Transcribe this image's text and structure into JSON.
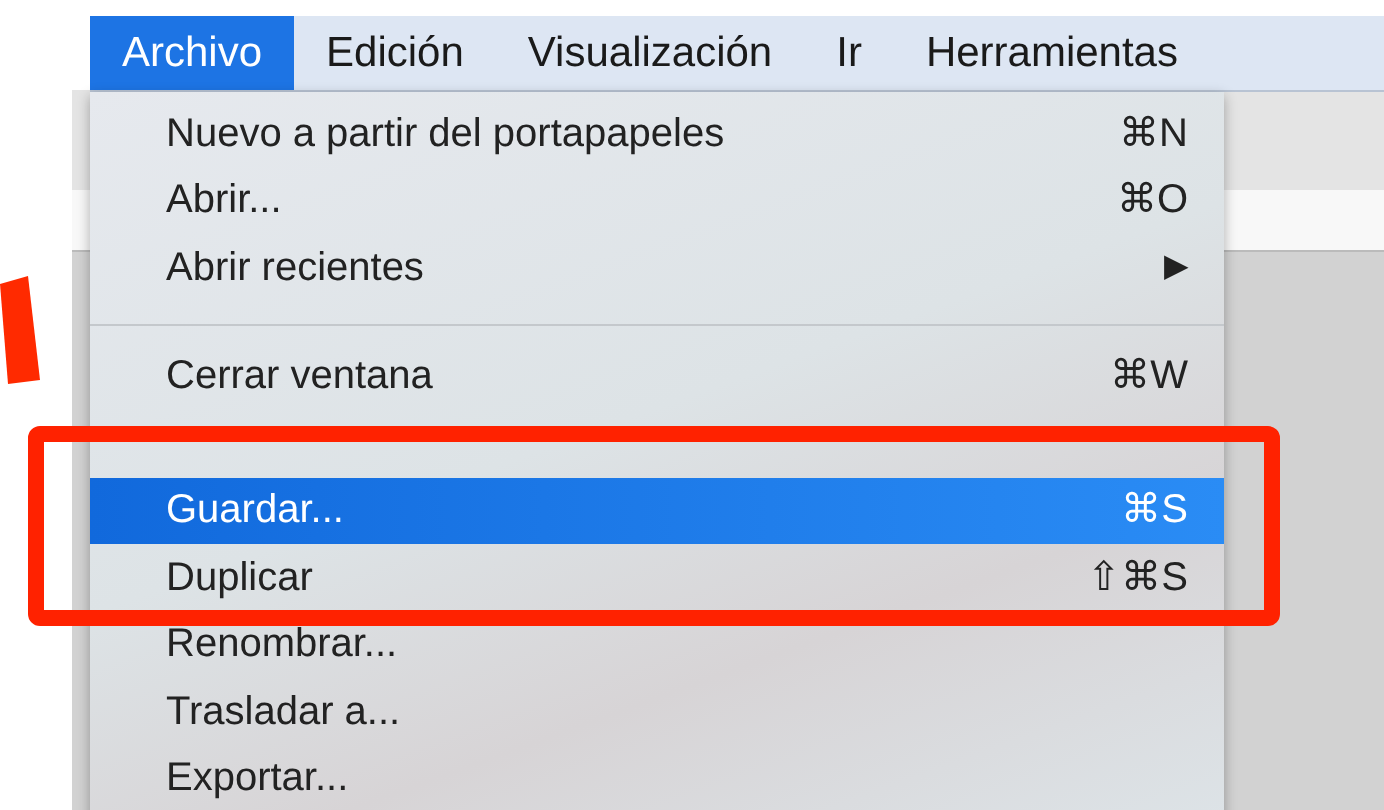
{
  "menu_bar": [
    {
      "label": "Archivo",
      "selected": true
    },
    {
      "label": "Edición",
      "selected": false
    },
    {
      "label": "Visualización",
      "selected": false
    },
    {
      "label": "Ir",
      "selected": false
    },
    {
      "label": "Herramientas",
      "selected": false
    }
  ],
  "menu": [
    {
      "kind": "item",
      "label": "Nuevo a partir del portapapeles",
      "shortcut": "⌘N",
      "selected": false
    },
    {
      "kind": "item",
      "label": "Abrir...",
      "shortcut": "⌘O",
      "selected": false
    },
    {
      "kind": "submenu",
      "label": "Abrir recientes",
      "shortcut": "▶",
      "selected": false
    },
    {
      "kind": "separator"
    },
    {
      "kind": "item",
      "label": "Cerrar ventana",
      "shortcut": "⌘W",
      "selected": false
    },
    {
      "kind": "covered"
    },
    {
      "kind": "item",
      "label": "Guardar...",
      "shortcut": "⌘S",
      "selected": true
    },
    {
      "kind": "item",
      "label": "Duplicar",
      "shortcut": "⇧⌘S",
      "selected": false
    },
    {
      "kind": "item",
      "label": "Renombrar...",
      "selected": false
    },
    {
      "kind": "item",
      "label": "Trasladar a...",
      "selected": false
    },
    {
      "kind": "item",
      "label": "Exportar...",
      "selected": false
    }
  ]
}
